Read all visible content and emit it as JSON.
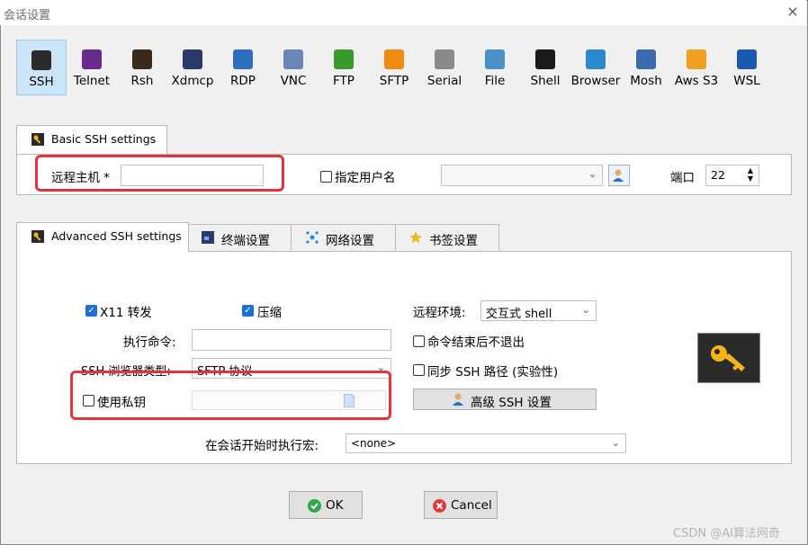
{
  "window": {
    "title": "会话设置",
    "close_glyph": "×"
  },
  "protocols": [
    {
      "label": "SSH",
      "icon": "ssh-key-icon",
      "color": "#2b2b2b",
      "selected": true
    },
    {
      "label": "Telnet",
      "icon": "telnet-icon",
      "color": "#6a2b8f"
    },
    {
      "label": "Rsh",
      "icon": "rsh-icon",
      "color": "#3a2a1a"
    },
    {
      "label": "Xdmcp",
      "icon": "xdmcp-icon",
      "color": "#2a3a6a"
    },
    {
      "label": "RDP",
      "icon": "rdp-icon",
      "color": "#2d6fbf"
    },
    {
      "label": "VNC",
      "icon": "vnc-icon",
      "color": "#6a86b8"
    },
    {
      "label": "FTP",
      "icon": "ftp-icon",
      "color": "#3a9a2a"
    },
    {
      "label": "SFTP",
      "icon": "sftp-icon",
      "color": "#f08a10"
    },
    {
      "label": "Serial",
      "icon": "serial-icon",
      "color": "#8a8a8a"
    },
    {
      "label": "File",
      "icon": "file-icon",
      "color": "#4a90c8"
    },
    {
      "label": "Shell",
      "icon": "shell-icon",
      "color": "#1a1a1a"
    },
    {
      "label": "Browser",
      "icon": "browser-icon",
      "color": "#2a8ad0"
    },
    {
      "label": "Mosh",
      "icon": "mosh-icon",
      "color": "#3a6ab0"
    },
    {
      "label": "Aws S3",
      "icon": "aws-s3-icon",
      "color": "#f0a020"
    },
    {
      "label": "WSL",
      "icon": "wsl-icon",
      "color": "#1a5ab0"
    }
  ],
  "basic": {
    "tab_label": "Basic SSH settings",
    "remote_host_label": "远程主机 *",
    "remote_host_value": "",
    "specify_user_label": "指定用户名",
    "specify_user_checked": false,
    "username_value": "",
    "port_label": "端口",
    "port_value": "22"
  },
  "advanced_tabs": [
    {
      "label": "Advanced SSH settings",
      "active": true
    },
    {
      "label": "终端设置",
      "active": false
    },
    {
      "label": "网络设置",
      "active": false
    },
    {
      "label": "书签设置",
      "active": false
    }
  ],
  "advanced": {
    "x11_label": "X11 转发",
    "x11_checked": true,
    "compress_label": "压缩",
    "compress_checked": true,
    "remote_env_label": "远程环境:",
    "remote_env_value": "交互式 shell",
    "exec_cmd_label": "执行命令:",
    "exec_cmd_value": "",
    "no_exit_label": "命令结束后不退出",
    "no_exit_checked": false,
    "browser_type_label": "SSH 浏览器类型:",
    "browser_type_value": "SFTP 协议",
    "sync_path_label": "同步 SSH 路径 (实验性)",
    "sync_path_checked": false,
    "use_key_label": "使用私钥",
    "use_key_checked": false,
    "key_path_value": "",
    "expert_btn_label": "高级 SSH 设置",
    "macro_label": "在会话开始时执行宏:",
    "macro_value": "<none>"
  },
  "buttons": {
    "ok": "OK",
    "cancel": "Cancel"
  },
  "watermark": "CSDN @AI算法网奇",
  "colors": {
    "highlight": "#e4343a",
    "selected_bg": "#cce4f7",
    "check_blue": "#1f6fd0"
  }
}
